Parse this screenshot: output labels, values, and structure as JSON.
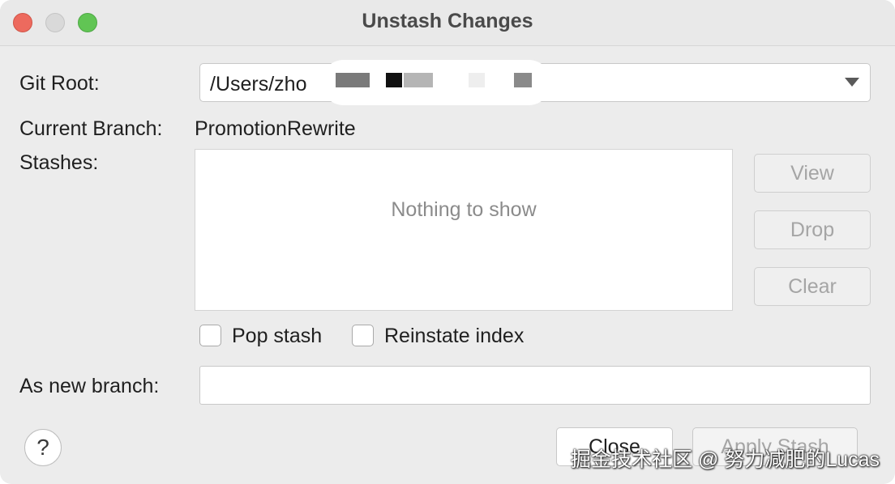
{
  "window": {
    "title": "Unstash Changes"
  },
  "git_root": {
    "label": "Git Root:",
    "value": "/Users/zho"
  },
  "current_branch": {
    "label": "Current Branch:",
    "value": "PromotionRewrite"
  },
  "stashes": {
    "label": "Stashes:",
    "empty_text": "Nothing to show",
    "items": []
  },
  "side_buttons": {
    "view": "View",
    "drop": "Drop",
    "clear": "Clear"
  },
  "options": {
    "pop_stash": {
      "label": "Pop stash",
      "checked": false
    },
    "reinstate_index": {
      "label": "Reinstate index",
      "checked": false
    }
  },
  "new_branch": {
    "label": "As new branch:",
    "value": ""
  },
  "footer": {
    "help_label": "?",
    "close_label": "Close",
    "apply_label": "Apply Stash"
  },
  "watermark": "掘金技术社区 @ 努力减肥的Lucas",
  "icons": {
    "help": "help-icon",
    "combo_arrow": "chevron-down-icon"
  },
  "colors": {
    "traffic_close": "#ed6a5e",
    "traffic_minimize": "#d9d9d9",
    "traffic_maximize": "#61c554",
    "disabled_text": "#a5a5a5"
  }
}
